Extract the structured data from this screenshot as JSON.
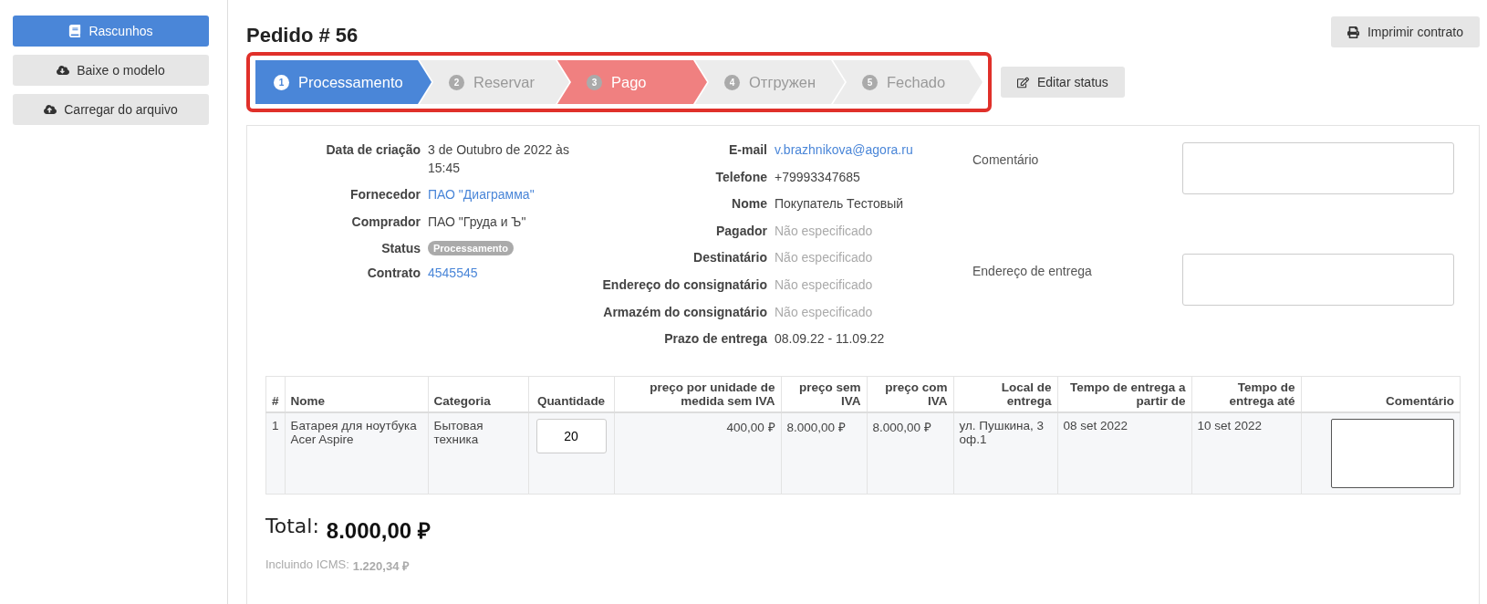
{
  "sidebar": {
    "buttons": [
      {
        "label": "Rascunhos",
        "kind": "primary"
      },
      {
        "label": "Baixe o modelo",
        "kind": "default"
      },
      {
        "label": "Carregar do arquivo",
        "kind": "default"
      }
    ]
  },
  "header": {
    "title": "Pedido # 56",
    "print_button": "Imprimir contrato",
    "edit_status_button": "Editar status"
  },
  "steps": [
    {
      "number": "1",
      "label": "Processamento",
      "kind": "current"
    },
    {
      "number": "2",
      "label": "Reservar",
      "kind": "pending"
    },
    {
      "number": "3",
      "label": "Pago",
      "kind": "alert"
    },
    {
      "number": "4",
      "label": "Отгружен",
      "kind": "pending"
    },
    {
      "number": "5",
      "label": "Fechado",
      "kind": "pending"
    }
  ],
  "details_left": [
    {
      "label": "Data de criação",
      "value": "3 de Outubro de 2022 às 15:45",
      "kind": "text"
    },
    {
      "label": "Fornecedor",
      "value": "ПАО \"Диаграмма\"",
      "kind": "link"
    },
    {
      "label": "Comprador",
      "value": "ПАО \"Груда и Ъ\"",
      "kind": "text"
    },
    {
      "label": "Status",
      "value": "Processamento",
      "kind": "badge"
    },
    {
      "label": "Contrato",
      "value": "4545545",
      "kind": "link"
    }
  ],
  "details_middle": [
    {
      "label": "E-mail",
      "value": "v.brazhnikova@agora.ru",
      "kind": "link"
    },
    {
      "label": "Telefone",
      "value": "+79993347685",
      "kind": "text"
    },
    {
      "label": "Nome",
      "value": "Покупатель Тестовый",
      "kind": "text"
    },
    {
      "label": "Pagador",
      "value": "Não especificado",
      "kind": "muted"
    },
    {
      "label": "Destinatário",
      "value": "Não especificado",
      "kind": "muted"
    },
    {
      "label": "Endereço do consignatário",
      "value": "Não especificado",
      "kind": "muted"
    },
    {
      "label": "Armazém do consignatário",
      "value": "Não especificado",
      "kind": "muted"
    },
    {
      "label": "Prazo de entrega",
      "value": "08.09.22 - 11.09.22",
      "kind": "text"
    }
  ],
  "details_right": [
    {
      "label": "Comentário"
    },
    {
      "label": "Endereço de entrega"
    }
  ],
  "table": {
    "columns": [
      "#",
      "Nome",
      "Categoria",
      "Quantidade",
      "preço por unidade de medida sem IVA",
      "preço sem IVA",
      "preço com IVA",
      "Local de entrega",
      "Tempo de entrega a partir de",
      "Tempo de entrega até",
      "Comentário"
    ],
    "rows": [
      {
        "number": "1",
        "name": "Батарея для ноутбука Acer Aspire",
        "category": "Бытовая техника",
        "quantity": "20",
        "unit_price": "400,00 ₽",
        "price_without_vat": "8.000,00 ₽",
        "price_with_vat": "8.000,00 ₽",
        "delivery_place": "ул. Пушкина, 3 оф.1",
        "delivery_from": "08 set 2022",
        "delivery_to": "10 set 2022"
      }
    ]
  },
  "total": {
    "label": "Total:",
    "value": "8.000,00 ₽",
    "tax_label": "Incluindo ICMS:",
    "tax_value": "1.220,34 ₽"
  }
}
